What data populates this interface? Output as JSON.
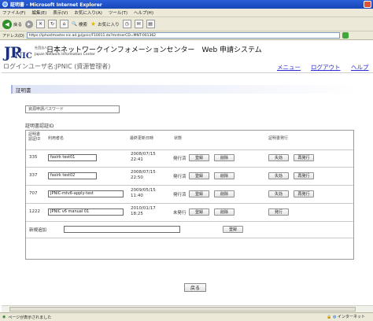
{
  "window": {
    "title": "証明書 - Microsoft Internet Explorer",
    "menu": [
      "ファイル(F)",
      "編集(E)",
      "表示(V)",
      "お気に入り(A)",
      "ツール(T)",
      "ヘルプ(H)"
    ],
    "toolbar": {
      "back_label": "戻る",
      "search_label": "検索",
      "favorites_label": "お気に入り"
    },
    "address": {
      "label": "アドレス(D)",
      "url": "https://iphostmaster.nic.ad.jp/jpnic/F10011.do?mntnerCD=MNT-001362"
    }
  },
  "header": {
    "logo_main": "JP",
    "logo_sub": "NIC",
    "org_prefix": "社団法人",
    "org_name": "日本ネットワークインフォメーションセンター　Web 申請システム",
    "org_en": "Japan Network Information Center",
    "user_line": "ログインユーザ名:JPNIC (資源管理者)",
    "nav": {
      "menu": "メニュー",
      "logout": "ログアウト",
      "help": "ヘルプ"
    }
  },
  "section": {
    "title": "証明書"
  },
  "password_field": {
    "value": "資源申請パスワード"
  },
  "cert_id_label": "証明書認証ID",
  "table": {
    "headers": {
      "id": "証明書認証ID",
      "user": "利用者名",
      "updated": "最終更新日時",
      "status": "状態",
      "issue": "証明書発行"
    },
    "rows": [
      {
        "id": "335",
        "user": "fasirk test01",
        "updated_date": "2008/07/15",
        "updated_time": "22:41",
        "status": "発行済",
        "register": "登録",
        "delete": "削除",
        "issue1": "失効",
        "issue2": "再発行"
      },
      {
        "id": "337",
        "user": "fasirk test02",
        "updated_date": "2008/07/15",
        "updated_time": "22:50",
        "status": "発行済",
        "register": "登録",
        "delete": "削除",
        "issue1": "失効",
        "issue2": "再発行"
      },
      {
        "id": "707",
        "user": "JPNIC-mtv6-apply-test",
        "updated_date": "2009/05/15",
        "updated_time": "11:40",
        "status": "発行済",
        "register": "登録",
        "delete": "削除",
        "issue1": "失効",
        "issue2": "再発行"
      },
      {
        "id": "1222",
        "user": "JPNIC v6 manual 01",
        "updated_date": "2010/01/17",
        "updated_time": "18:25",
        "status": "未発行",
        "register": "登録",
        "delete": "削除",
        "issue1": "発行",
        "issue2": ""
      }
    ],
    "new_row": {
      "label": "新規追加",
      "input_value": "",
      "register": "登録"
    }
  },
  "return_button": "戻る",
  "status": {
    "text": "ページが表示されました",
    "zone": "インターネット"
  },
  "colors": {
    "accent_link": "#2b2bd6",
    "logo": "#1c2f7a",
    "title_bar": "#2a5fd8"
  }
}
